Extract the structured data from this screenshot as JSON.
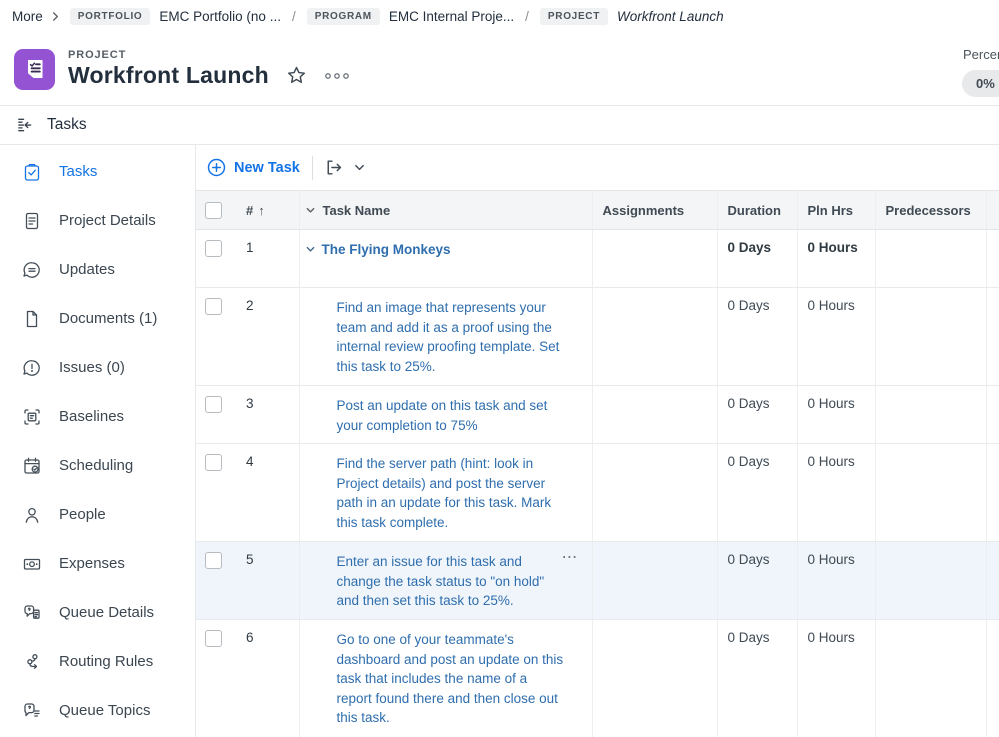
{
  "breadcrumb": {
    "more_label": "More",
    "separator": "/",
    "items": [
      {
        "badge": "PORTFOLIO",
        "label": "EMC Portfolio (no ..."
      },
      {
        "badge": "PROGRAM",
        "label": "EMC Internal Proje..."
      },
      {
        "badge": "PROJECT",
        "label": "Workfront Launch"
      }
    ]
  },
  "header": {
    "eyebrow": "PROJECT",
    "title": "Workfront Launch",
    "icon": "project-tasklist-icon",
    "icon_color": "#9353d3",
    "star_icon": "star-outline-icon",
    "more_icon": "ellipsis-icon",
    "percent_label": "Percer",
    "percent_value": "0%"
  },
  "section_bar": {
    "label": "Tasks",
    "icon": "collapse-panel-icon"
  },
  "sidebar": {
    "items": [
      {
        "icon": "tasks",
        "label": "Tasks",
        "active": true
      },
      {
        "icon": "project-details",
        "label": "Project Details",
        "active": false
      },
      {
        "icon": "updates",
        "label": "Updates",
        "active": false
      },
      {
        "icon": "documents",
        "label": "Documents (1)",
        "active": false
      },
      {
        "icon": "issues",
        "label": "Issues (0)",
        "active": false
      },
      {
        "icon": "baselines",
        "label": "Baselines",
        "active": false
      },
      {
        "icon": "scheduling",
        "label": "Scheduling",
        "active": false
      },
      {
        "icon": "people",
        "label": "People",
        "active": false
      },
      {
        "icon": "expenses",
        "label": "Expenses",
        "active": false
      },
      {
        "icon": "queue-details",
        "label": "Queue Details",
        "active": false
      },
      {
        "icon": "routing-rules",
        "label": "Routing Rules",
        "active": false
      },
      {
        "icon": "queue-topics",
        "label": "Queue Topics",
        "active": false
      }
    ]
  },
  "task_toolbar": {
    "new_task_label": "New Task",
    "new_task_icon": "circle-plus-icon",
    "export_icon": "export-arrow-icon",
    "dropdown_icon": "chevron-down-icon",
    "accent_color": "#1473e6"
  },
  "table": {
    "headers": {
      "number": "#",
      "sort_arrow": "↑",
      "task_name": "Task Name",
      "assignments": "Assignments",
      "duration": "Duration",
      "pln_hrs": "Pln Hrs",
      "predecessors": "Predecessors"
    },
    "link_color": "#2f6eae",
    "highlight_color": "#f0f5fb",
    "rows": [
      {
        "number": "1",
        "name": "The Flying Monkeys",
        "assignments": "",
        "duration": "0 Days",
        "pln_hrs": "0 Hours",
        "predecessors": "",
        "parent": true,
        "highlighted": false,
        "has_more": false
      },
      {
        "number": "2",
        "name": "Find an image that represents your team and add it as a proof using the internal review proofing template. Set this task to 25%.",
        "assignments": "",
        "duration": "0 Days",
        "pln_hrs": "0 Hours",
        "predecessors": "",
        "parent": false,
        "highlighted": false,
        "has_more": false
      },
      {
        "number": "3",
        "name": "Post an update on this task and set your completion to 75%",
        "assignments": "",
        "duration": "0 Days",
        "pln_hrs": "0 Hours",
        "predecessors": "",
        "parent": false,
        "highlighted": false,
        "has_more": false
      },
      {
        "number": "4",
        "name": "Find the server path (hint: look in Project details) and post the server path in an update for this task. Mark this task complete.",
        "assignments": "",
        "duration": "0 Days",
        "pln_hrs": "0 Hours",
        "predecessors": "",
        "parent": false,
        "highlighted": false,
        "has_more": false
      },
      {
        "number": "5",
        "name": "Enter an issue for this task and change the task status to \"on hold\" and then set this task to 25%.",
        "assignments": "",
        "duration": "0 Days",
        "pln_hrs": "0 Hours",
        "predecessors": "",
        "parent": false,
        "highlighted": true,
        "has_more": true
      },
      {
        "number": "6",
        "name": "Go to one of your teammate's dashboard and post an update on this task that includes the name of a report found there and then close out this task.",
        "assignments": "",
        "duration": "0 Days",
        "pln_hrs": "0 Hours",
        "predecessors": "",
        "parent": false,
        "highlighted": false,
        "has_more": false
      }
    ]
  }
}
